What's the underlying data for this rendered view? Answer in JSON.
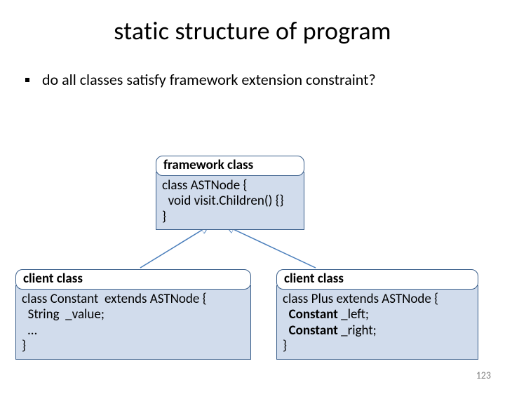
{
  "title": "static structure of program",
  "bullet": "do all classes satisfy framework extension constraint?",
  "framework": {
    "label": "framework class",
    "code": "class ASTNode {\n  void visit.Children() {}\n}"
  },
  "client_left": {
    "label": "client class",
    "line1": "class Constant  extends ASTNode {",
    "line2": "  String  _value;",
    "line3": "  …",
    "line4": "}"
  },
  "client_right": {
    "label": "client class",
    "line1": "class Plus extends ASTNode {",
    "line2_prefix": "  ",
    "line2_bold": "Constant",
    "line2_rest": " _left;",
    "line3_prefix": "  ",
    "line3_bold": "Constant",
    "line3_rest": " _right;",
    "line4": "}"
  },
  "page_number": "123"
}
